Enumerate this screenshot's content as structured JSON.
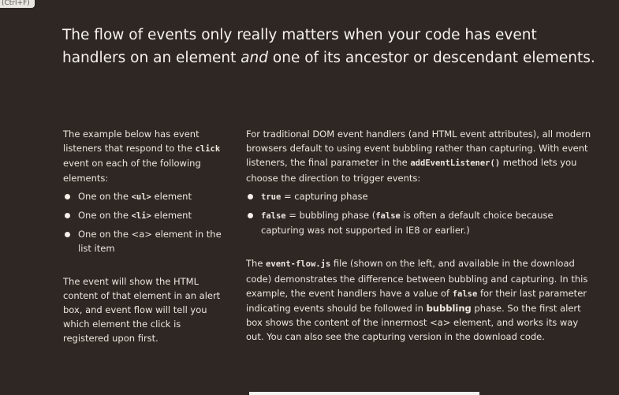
{
  "corner_tag": "(Ctrl+F)",
  "headline": {
    "part1": "The flow of events only really matters when your code has event handlers on an element ",
    "emphasis": "and",
    "part2": " one of its ancestor or descendant elements."
  },
  "left": {
    "intro_pre": "The example below has event listeners that respond to the ",
    "intro_code": "click",
    "intro_post": " event on each of the following elements:",
    "items": [
      {
        "pre": "One on the ",
        "code": "<ul>",
        "post": " element"
      },
      {
        "pre": "One on the ",
        "code": "<li>",
        "post": " element"
      },
      {
        "pre": "One on the ",
        "code": "<a>",
        "post": " element in the list item"
      }
    ],
    "outro": "The event will show the HTML content of that element in an alert box, and event flow will tell you which element the click is registered upon first."
  },
  "right": {
    "para1_pre": "For traditional DOM event handlers (and HTML event attributes), all modern browsers default to using event bubbling rather than capturing. With event listeners, the final parameter in the ",
    "para1_code": "addEventListener()",
    "para1_post": " method lets you choose the direction to trigger events:",
    "items": [
      {
        "code": "true",
        "text": " = capturing phase",
        "code2": "",
        "text2": ""
      },
      {
        "code": "false",
        "text": " = bubbling phase (",
        "code2": "false",
        "text2": " is often a default choice because capturing was not supported in IE8 or earlier.)"
      }
    ],
    "para2": {
      "s1": "The ",
      "c1": "event-flow.js",
      "s2": " file (shown on the left, and available in the download code) demonstrates the difference between bubbling and capturing. In this example, the event handlers have a value of ",
      "c2": "false",
      "s3": " for their last parameter indicating events should be followed in ",
      "b1": "bubbling",
      "s4": " phase. So the first alert box shows the content of the innermost ",
      "c3": "<a>",
      "s5": " element, and works its way out. You can also see the capturing version in the download code."
    }
  }
}
